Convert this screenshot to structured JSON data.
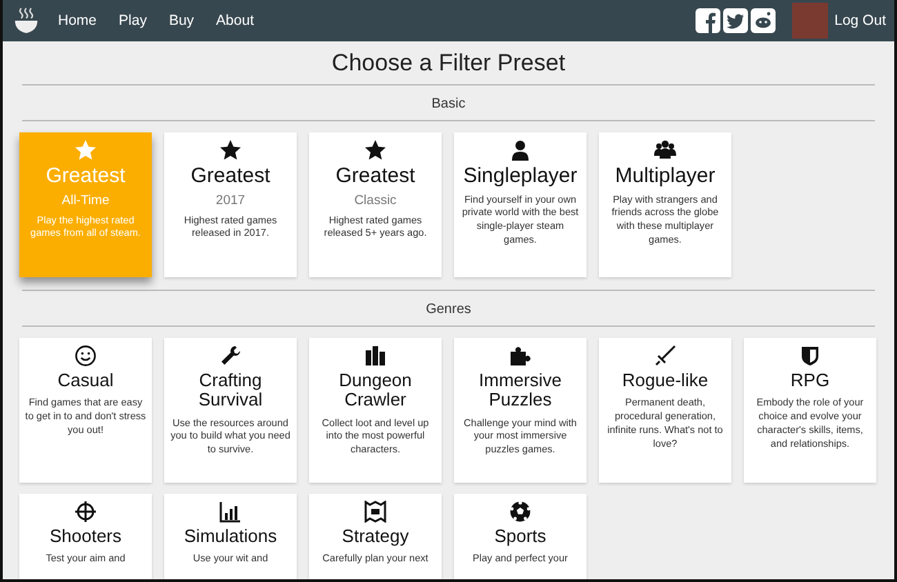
{
  "nav": {
    "links": [
      {
        "label": "Home"
      },
      {
        "label": "Play"
      },
      {
        "label": "Buy"
      },
      {
        "label": "About"
      }
    ],
    "logout": "Log Out"
  },
  "title": "Choose a Filter Preset",
  "sections": [
    {
      "heading": "Basic",
      "cards": [
        {
          "title": "Greatest",
          "subtitle": "All-Time",
          "description": "Play the highest rated games from all of steam.",
          "selected": true
        },
        {
          "title": "Greatest",
          "subtitle": "2017",
          "description": "Highest rated games released in 2017.",
          "selected": false
        },
        {
          "title": "Greatest",
          "subtitle": "Classic",
          "description": "Highest rated games released 5+ years ago.",
          "selected": false
        },
        {
          "title": "Singleplayer",
          "description": "Find yourself in your own private world with the best single-player steam games.",
          "selected": false
        },
        {
          "title": "Multiplayer",
          "description": "Play with strangers and friends across the globe with these multiplayer games.",
          "selected": false
        }
      ]
    },
    {
      "heading": "Genres",
      "cards": [
        {
          "title": "Casual",
          "description": "Find games that are easy to get in to and don't stress you out!",
          "selected": false
        },
        {
          "title": "Crafting Survival",
          "description": "Use the resources around you to build what you need to survive.",
          "selected": false
        },
        {
          "title": "Dungeon Crawler",
          "description": "Collect loot and level up into the most powerful characters.",
          "selected": false
        },
        {
          "title": "Immersive Puzzles",
          "description": "Challenge your mind with your most immersive puzzles games.",
          "selected": false
        },
        {
          "title": "Rogue-like",
          "description": "Permanent death, procedural generation, infinite runs. What's not to love?",
          "selected": false
        },
        {
          "title": "RPG",
          "description": "Embody the role of your choice and evolve your character's skills, items, and relationships.",
          "selected": false
        },
        {
          "title": "Shooters",
          "description": "Test your aim and",
          "selected": false
        },
        {
          "title": "Simulations",
          "description": "Use your wit and",
          "selected": false
        },
        {
          "title": "Strategy",
          "description": "Carefully plan your next",
          "selected": false
        },
        {
          "title": "Sports",
          "description": "Play and perfect your",
          "selected": false
        }
      ]
    }
  ]
}
